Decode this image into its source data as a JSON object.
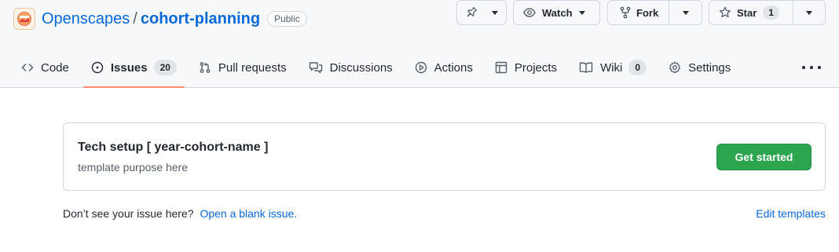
{
  "repo": {
    "owner": "Openscapes",
    "separator": "/",
    "name": "cohort-planning",
    "visibility": "Public"
  },
  "actions": {
    "pin_icon": "pin-icon",
    "watch_label": "Watch",
    "fork_label": "Fork",
    "star_label": "Star",
    "star_count": "1"
  },
  "tabs": [
    {
      "label": "Code",
      "icon": "code-icon"
    },
    {
      "label": "Issues",
      "icon": "issue-opened-icon",
      "count": "20",
      "selected": true
    },
    {
      "label": "Pull requests",
      "icon": "git-pull-request-icon"
    },
    {
      "label": "Discussions",
      "icon": "comment-discussion-icon"
    },
    {
      "label": "Actions",
      "icon": "play-icon"
    },
    {
      "label": "Projects",
      "icon": "table-icon"
    },
    {
      "label": "Wiki",
      "icon": "book-icon",
      "count": "0"
    },
    {
      "label": "Settings",
      "icon": "gear-icon"
    }
  ],
  "template": {
    "title": "Tech setup [ year-cohort-name ]",
    "description": "template purpose here",
    "button_label": "Get started"
  },
  "footer": {
    "prompt": "Don’t see your issue here?",
    "blank_issue_link": "Open a blank issue.",
    "edit_templates_link": "Edit templates"
  },
  "colors": {
    "link": "#0969da",
    "primary_button": "#2da44e",
    "selected_tab_underline": "#fd8c73"
  }
}
